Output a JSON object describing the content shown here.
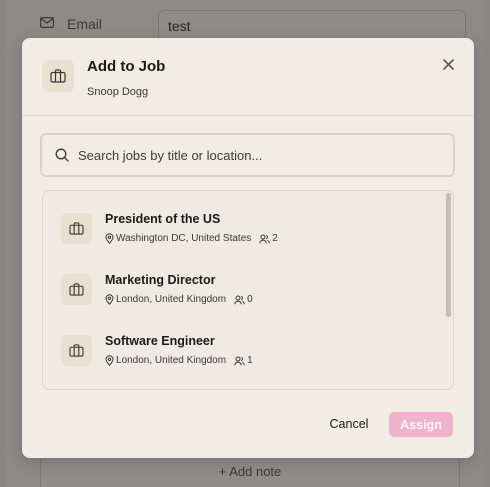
{
  "background": {
    "email_label": "Email",
    "email_value": "test",
    "add_note_label": "+ Add note"
  },
  "modal": {
    "title": "Add to Job",
    "subtitle": "Snoop Dogg",
    "header_icon": "briefcase-icon",
    "close_icon": "close-icon",
    "search": {
      "placeholder": "Search jobs by title or location...",
      "value": ""
    },
    "jobs": [
      {
        "title": "President of the US",
        "location": "Washington DC, United States",
        "count": "2"
      },
      {
        "title": "Marketing Director",
        "location": "London, United Kingdom",
        "count": "0"
      },
      {
        "title": "Software Engineer",
        "location": "London, United Kingdom",
        "count": "1"
      }
    ],
    "cancel_label": "Cancel",
    "assign_label": "Assign"
  },
  "colors": {
    "modal_bg": "#f1ede5",
    "icon_tile": "#e7e1d2",
    "assign_disabled": "#f0b3cc",
    "overlay": "#8d8b88"
  }
}
